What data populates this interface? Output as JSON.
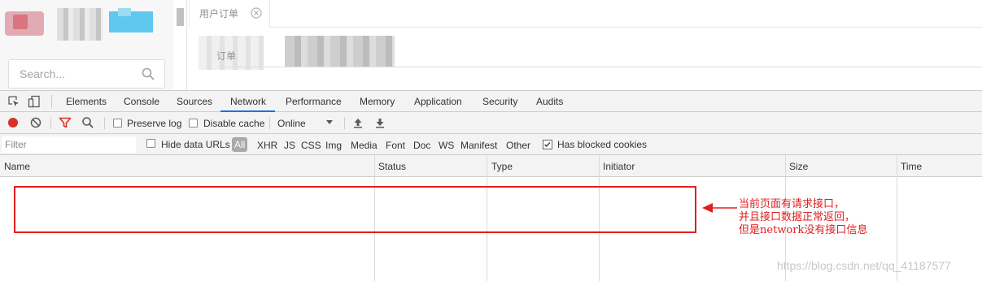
{
  "sidebar": {
    "search_placeholder": "Search..."
  },
  "page_tabs": [
    {
      "label": "用户订单"
    }
  ],
  "content": {
    "field_label": "订单"
  },
  "devtools": {
    "tabs": [
      {
        "label": "Elements"
      },
      {
        "label": "Console"
      },
      {
        "label": "Sources"
      },
      {
        "label": "Network",
        "active": true
      },
      {
        "label": "Performance"
      },
      {
        "label": "Memory"
      },
      {
        "label": "Application"
      },
      {
        "label": "Security"
      },
      {
        "label": "Audits"
      }
    ],
    "toolbar": {
      "preserve_log": "Preserve log",
      "preserve_log_checked": false,
      "disable_cache": "Disable cache",
      "disable_cache_checked": false,
      "throttling": "Online"
    },
    "filter": {
      "placeholder": "Filter",
      "hide_data_urls": "Hide data URLs",
      "types": [
        "All",
        "XHR",
        "JS",
        "CSS",
        "Img",
        "Media",
        "Font",
        "Doc",
        "WS",
        "Manifest",
        "Other"
      ],
      "selected_type": "All",
      "has_blocked_cookies": "Has blocked cookies",
      "has_blocked_cookies_checked": true
    },
    "columns": [
      "Name",
      "Status",
      "Type",
      "Initiator",
      "Size",
      "Time"
    ],
    "rows": []
  },
  "annotation": {
    "lines": [
      "当前页面有请求接口，",
      "并且接口数据正常返回，",
      "但是network没有接口信息"
    ],
    "color": "#e02020"
  },
  "watermark": "https://blog.csdn.net/qq_41187577",
  "colors": {
    "record_red": "#d93025",
    "filter_red": "#d93025",
    "accent_blue": "#1a73e8"
  }
}
